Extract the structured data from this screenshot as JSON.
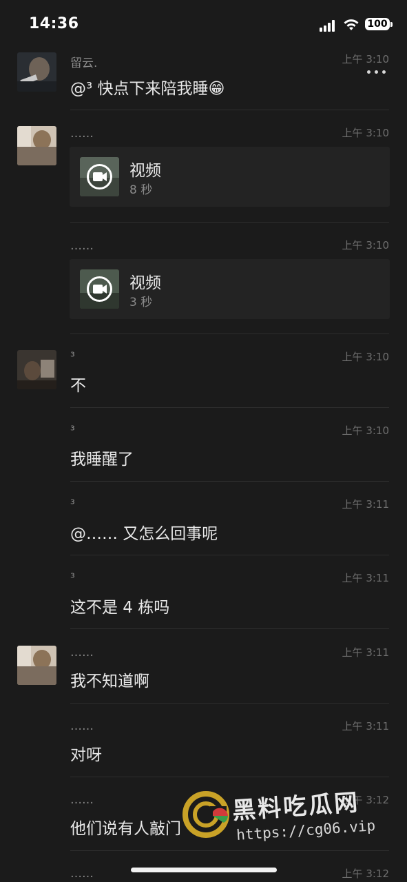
{
  "status_bar": {
    "time": "14:36",
    "battery": "100"
  },
  "messages": [
    {
      "sender": "留云.",
      "time": "上午 3:10",
      "text": "@³ 快点下来陪我睡😁"
    },
    {
      "sender": "……",
      "time": "上午 3:10",
      "video": {
        "label": "视频",
        "duration": "8 秒"
      }
    },
    {
      "sender": "……",
      "time": "上午 3:10",
      "video": {
        "label": "视频",
        "duration": "3 秒"
      }
    },
    {
      "sender": "³",
      "time": "上午 3:10",
      "text": "不"
    },
    {
      "sender": "³",
      "time": "上午 3:10",
      "text": "我睡醒了"
    },
    {
      "sender": "³",
      "time": "上午 3:11",
      "text": "@…… 又怎么回事呢"
    },
    {
      "sender": "³",
      "time": "上午 3:11",
      "text": "这不是 4 栋吗"
    },
    {
      "sender": "……",
      "time": "上午 3:11",
      "text": "我不知道啊"
    },
    {
      "sender": "……",
      "time": "上午 3:11",
      "text": "对呀"
    },
    {
      "sender": "……",
      "time": "上午 3:12",
      "text": "他们说有人敲门"
    },
    {
      "sender": "……",
      "time": "上午 3:12"
    }
  ],
  "watermark": {
    "title": "黑料吃瓜网",
    "url": "https://cg06.vip"
  },
  "icons": [
    "more-icon",
    "video-camera-icon",
    "signal-icon",
    "wifi-icon",
    "battery-icon"
  ],
  "colors": {
    "background": "#1b1b1b",
    "card": "#232323",
    "text": "#e8e8e8",
    "muted": "#8a8a8a",
    "watermark_accent": "#c9a227"
  }
}
